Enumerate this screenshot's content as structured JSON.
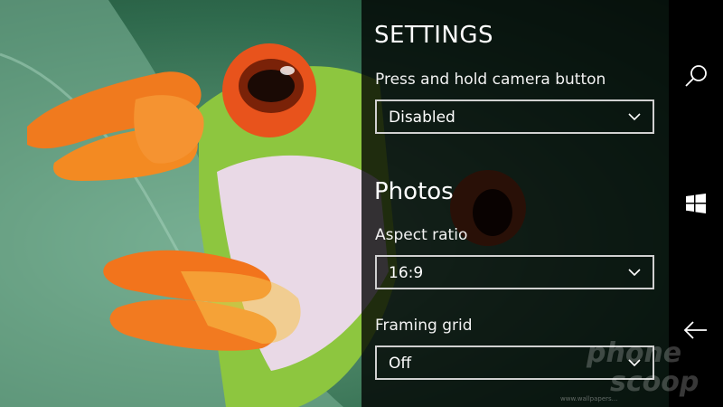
{
  "settings": {
    "title": "SETTINGS",
    "camera_button": {
      "label": "Press and hold camera button",
      "value": "Disabled"
    },
    "photos_section": "Photos",
    "aspect_ratio": {
      "label": "Aspect ratio",
      "value": "16:9"
    },
    "framing_grid": {
      "label": "Framing grid",
      "value": "Off"
    }
  },
  "system_bar": {
    "icons": [
      "search-icon",
      "windows-start-icon",
      "back-icon"
    ]
  },
  "watermark": {
    "line1": "phone",
    "line2": "scoop"
  },
  "credit": "www.wallpapers..."
}
